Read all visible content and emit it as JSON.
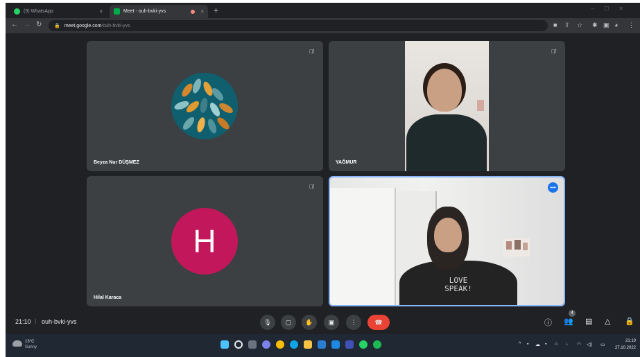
{
  "browser": {
    "tabs": [
      {
        "label": "(9) WhatsApp",
        "close": "×",
        "active": false,
        "favicon_color": "#25d366"
      },
      {
        "label": "Meet - ouh-bvki-yvs",
        "close": "×",
        "active": true,
        "favicon_color": "#00ac47"
      }
    ],
    "new_tab": "+",
    "url_host": "meet.google.com",
    "url_path": "/ouh-bvki-yvs"
  },
  "meet": {
    "participants": [
      {
        "name": "Beyza Nur DÜŞMEZ",
        "muted": true,
        "tile": "avatar-image"
      },
      {
        "name": "YAĞMUR",
        "muted": true,
        "tile": "video"
      },
      {
        "name": "Hilal Karaca",
        "muted": true,
        "tile": "initial-avatar",
        "initial": "H",
        "avatar_color": "#c2185b"
      },
      {
        "name": "",
        "tile": "self-video",
        "highlighted": true,
        "shirt_text": "LOVE\nSPEAK!"
      }
    ],
    "time": "21:10",
    "separator": "|",
    "meeting_code": "ouh-bvki-yvs",
    "controls": [
      "mic-icon",
      "camera-icon",
      "raise-hand-icon",
      "present-icon",
      "more-options-icon",
      "leave-call-icon"
    ],
    "right_controls": [
      "info-icon",
      "people-icon",
      "chat-icon",
      "activities-icon",
      "host-controls-icon"
    ],
    "people_count": "4",
    "accent_color": "#8ab4f8",
    "leave_color": "#ea4335"
  },
  "taskbar": {
    "weather_temp": "13°C",
    "weather_desc": "Sunny",
    "time": "21:10",
    "date": "27.10.2022"
  }
}
